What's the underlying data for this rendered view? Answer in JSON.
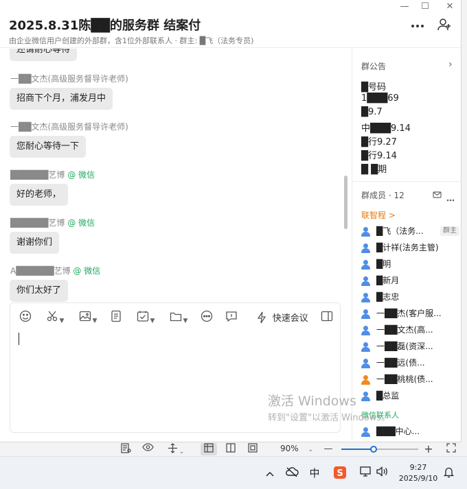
{
  "window": {
    "title": "2025.8.31陈██的服务群 结案付",
    "subtitle": "由企业微信用户创建的外部群，含1位外部联系人 · 群主: █飞（法务专员)",
    "controls": {
      "minimize": "—",
      "maximize": "☐",
      "close": "✕"
    },
    "more_icon": "more-icon",
    "add_member_icon": "add-member-icon"
  },
  "chat": {
    "messages": [
      {
        "name": "",
        "text": "还请耐心等待",
        "partial": true
      },
      {
        "name": "一██文杰(高级服务督导许老师)",
        "wx": "",
        "text": "招商下个月，浦发月中"
      },
      {
        "name": "一██文杰(高级服务督导许老师)",
        "wx": "",
        "text": "您耐心等待一下"
      },
      {
        "name": "██████艺博",
        "wx": "@ 微信",
        "text": "好的老师，"
      },
      {
        "name": "██████艺博",
        "wx": "@ 微信",
        "text": "谢谢你们"
      },
      {
        "name": "A██████艺博",
        "wx": "@ 微信",
        "text": "你们太好了"
      }
    ]
  },
  "composer": {
    "quick_meeting": "快速会议",
    "input_value": ""
  },
  "sidebar": {
    "notice_title": "群公告",
    "notice_lines": [
      "█号码",
      "1███69",
      "█9.7",
      "中███9.14",
      "█行9.27",
      "█行9.14",
      "█ █期"
    ],
    "members_title": "群成员 · 12",
    "group_link": "联智程 >",
    "members": [
      {
        "label": "█飞（法务...",
        "badge": "群主",
        "orange": false
      },
      {
        "label": "█计祥(法务主管)",
        "badge": "",
        "orange": false
      },
      {
        "label": "█明",
        "badge": "",
        "orange": false
      },
      {
        "label": "█新月",
        "badge": "",
        "orange": false
      },
      {
        "label": "█志忠",
        "badge": "",
        "orange": false
      },
      {
        "label": "一██杰(客户服...",
        "badge": "",
        "orange": false
      },
      {
        "label": "一██文杰(高...",
        "badge": "",
        "orange": false
      },
      {
        "label": "一██磊(资深...",
        "badge": "",
        "orange": false
      },
      {
        "label": "一██远(债...",
        "badge": "",
        "orange": false
      },
      {
        "label": "一██桃桃(债...",
        "badge": "",
        "orange": true
      },
      {
        "label": "█总监",
        "badge": "",
        "orange": false
      }
    ],
    "wechat_contacts_title": "微信联系人",
    "wechat_contact": "███中心..."
  },
  "watermark": {
    "line1": "激活 Windows",
    "line2": "转到\"设置\"以激活 Windows。"
  },
  "statusbar": {
    "zoom_level": "90%",
    "zoom_fraction": 0.42
  },
  "taskbar": {
    "ime_label": "中",
    "time": "9:27",
    "date": "2025/9/10"
  }
}
